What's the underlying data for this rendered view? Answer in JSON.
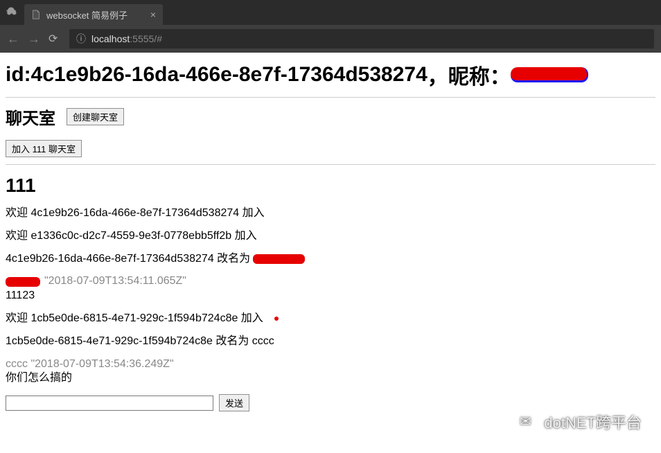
{
  "browser": {
    "tab_title": "websocket 简易例子",
    "url_host": "localhost",
    "url_port": ":5555/#"
  },
  "header": {
    "id_prefix": "id: ",
    "id_value": "4c1e9b26-16da-466e-8e7f-17364d538274",
    "separator": "，",
    "nickname_label": "昵称：",
    "nickname_value": ""
  },
  "chatrooms": {
    "heading": "聊天室",
    "create_label": "创建聊天室",
    "join_label": "加入 111 聊天室"
  },
  "room": {
    "name": "111",
    "messages": [
      "欢迎 4c1e9b26-16da-466e-8e7f-17364d538274 加入",
      "欢迎 e1336c0c-d2c7-4559-9e3f-0778ebb5ff2b 加入"
    ],
    "rename_msg": "4c1e9b26-16da-466e-8e7f-17364d538274 改名为 ",
    "gray_ts_1_time": "\"2018-07-09T13:54:11.065Z\"",
    "msg_body_1": "11123",
    "welcome_3": "欢迎 1cb5e0de-6815-4e71-929c-1f594b724c8e 加入",
    "rename_3": "1cb5e0de-6815-4e71-929c-1f594b724c8e 改名为 cccc",
    "gray_ts_2": "cccc \"2018-07-09T13:54:36.249Z\"",
    "msg_body_2": "你们怎么搞的"
  },
  "compose": {
    "input_value": "",
    "send_label": "发送"
  },
  "watermark": {
    "text": "dotNET跨平台"
  }
}
